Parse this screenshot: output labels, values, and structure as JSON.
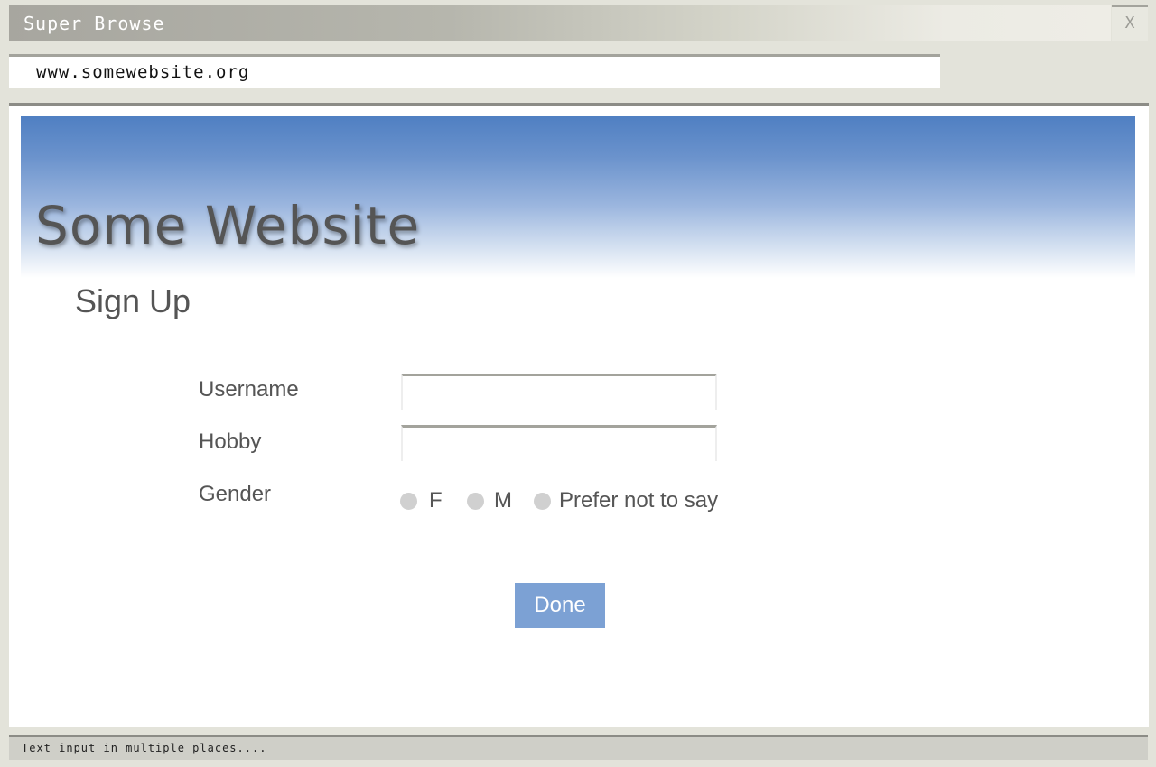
{
  "browser": {
    "title": "Super Browse",
    "close_label": "X",
    "url": "www.somewebsite.org",
    "status": "Text input in multiple places...."
  },
  "page": {
    "site_title": "Some Website",
    "heading": "Sign Up",
    "form": {
      "username_label": "Username",
      "username_value": "",
      "hobby_label": "Hobby",
      "hobby_value": "",
      "gender_label": "Gender",
      "gender_options": [
        "F",
        "M",
        "Prefer not to say"
      ],
      "gender_selected": null,
      "submit_label": "Done"
    }
  },
  "colors": {
    "header_top": "#4f7fc2",
    "button": "#7ca1d4",
    "text": "#555555"
  }
}
